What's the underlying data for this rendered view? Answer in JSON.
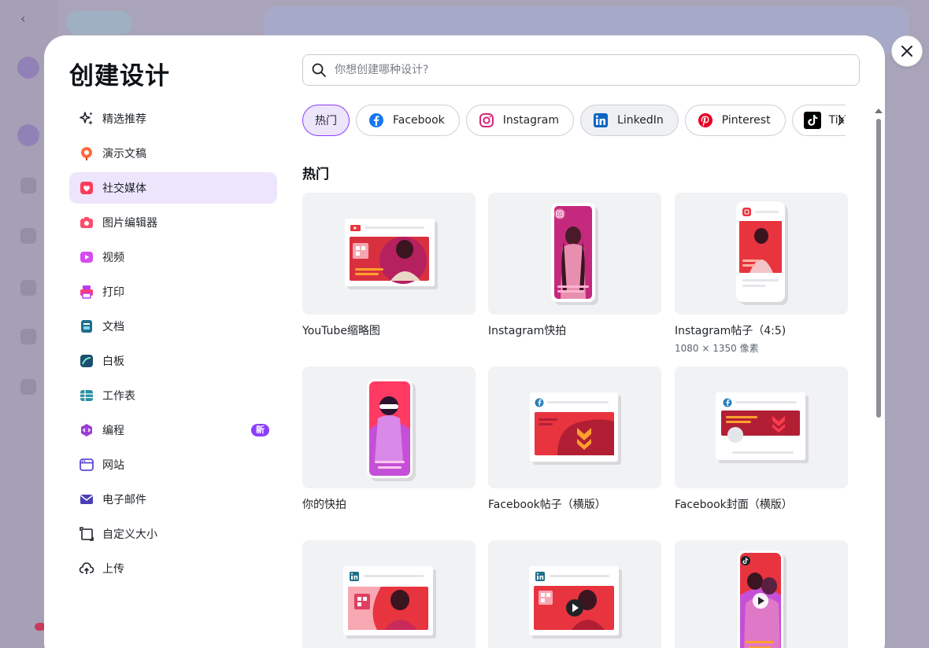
{
  "modal": {
    "title": "创建设计",
    "search": {
      "placeholder": "你想创建哪种设计?",
      "value": ""
    }
  },
  "nav": {
    "items": [
      {
        "id": "featured",
        "label": "精选推荐",
        "icon": "sparkle-icon"
      },
      {
        "id": "presentation",
        "label": "演示文稿",
        "icon": "presentation-icon"
      },
      {
        "id": "social",
        "label": "社交媒体",
        "icon": "heart-icon",
        "active": true
      },
      {
        "id": "photo",
        "label": "图片编辑器",
        "icon": "camera-icon"
      },
      {
        "id": "video",
        "label": "视频",
        "icon": "video-icon"
      },
      {
        "id": "print",
        "label": "打印",
        "icon": "printer-icon"
      },
      {
        "id": "docs",
        "label": "文档",
        "icon": "document-icon"
      },
      {
        "id": "whiteboard",
        "label": "白板",
        "icon": "whiteboard-icon"
      },
      {
        "id": "sheets",
        "label": "工作表",
        "icon": "sheet-icon"
      },
      {
        "id": "code",
        "label": "编程",
        "icon": "code-icon",
        "badge": "新"
      },
      {
        "id": "website",
        "label": "网站",
        "icon": "website-icon"
      },
      {
        "id": "email",
        "label": "电子邮件",
        "icon": "email-icon"
      },
      {
        "id": "custom",
        "label": "自定义大小",
        "icon": "custom-size-icon"
      },
      {
        "id": "upload",
        "label": "上传",
        "icon": "upload-icon"
      }
    ]
  },
  "chips": [
    {
      "label": "热门",
      "icon": ""
    },
    {
      "label": "Facebook",
      "icon": "facebook-icon"
    },
    {
      "label": "Instagram",
      "icon": "instagram-icon"
    },
    {
      "label": "LinkedIn",
      "icon": "linkedin-icon"
    },
    {
      "label": "Pinterest",
      "icon": "pinterest-icon"
    },
    {
      "label": "TikTok",
      "icon": "tiktok-icon"
    }
  ],
  "section": {
    "title": "热门"
  },
  "cards": [
    {
      "title": "YouTube缩略图",
      "subtitle": ""
    },
    {
      "title": "Instagram快拍",
      "subtitle": ""
    },
    {
      "title": "Instagram帖子（4:5)",
      "subtitle": "1080 × 1350 像素"
    },
    {
      "title": "你的快拍",
      "subtitle": ""
    },
    {
      "title": "Facebook帖子（横版）",
      "subtitle": ""
    },
    {
      "title": "Facebook封面（横版）",
      "subtitle": ""
    },
    {
      "title": "",
      "subtitle": ""
    },
    {
      "title": "",
      "subtitle": ""
    },
    {
      "title": "",
      "subtitle": ""
    }
  ],
  "colors": {
    "accent": "#8b3dff",
    "accent_soft": "#ece5fc",
    "template_red": "#e8343f",
    "template_magenta": "#c4297d",
    "facebook": "#1877f2",
    "linkedin": "#0a66c2",
    "pinterest": "#e60023"
  }
}
